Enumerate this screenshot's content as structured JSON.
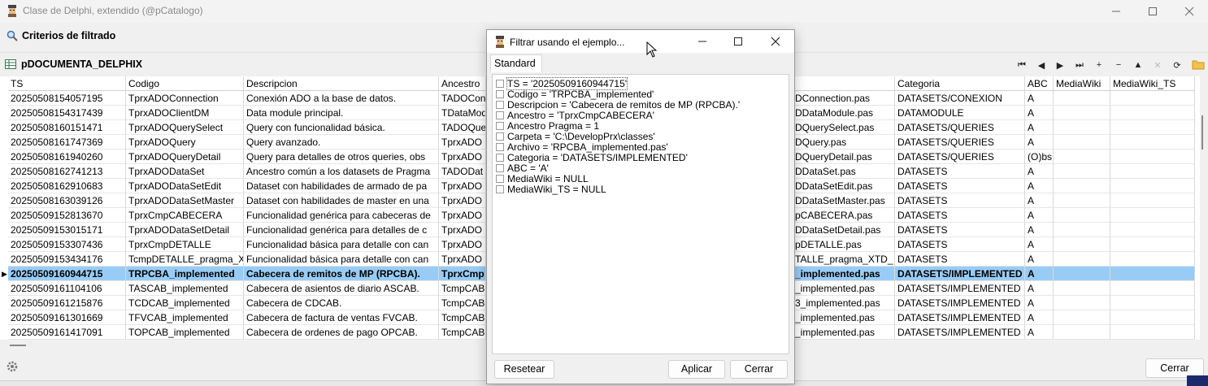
{
  "window": {
    "title": "Clase de Delphi, extendido (@pCatalogo)",
    "minimize": "—",
    "maximize": "☐",
    "close": "✕"
  },
  "filter_section": {
    "label": "Criterios de filtrado"
  },
  "dataset": {
    "name": "pDOCUMENTA_DELPHIX"
  },
  "nav_buttons": [
    {
      "name": "first-record-button",
      "glyph": "⏮"
    },
    {
      "name": "prior-record-button",
      "glyph": "◀"
    },
    {
      "name": "next-record-button",
      "glyph": "▶"
    },
    {
      "name": "last-record-button",
      "glyph": "⏭"
    },
    {
      "name": "insert-record-button",
      "glyph": "+"
    },
    {
      "name": "delete-record-button",
      "glyph": "−"
    },
    {
      "name": "edit-record-button",
      "glyph": "▲"
    },
    {
      "name": "cancel-edit-button",
      "glyph": "✕"
    },
    {
      "name": "refresh-button",
      "glyph": "⟳"
    }
  ],
  "grid": {
    "columns": [
      "TS",
      "Codigo",
      "Descripcion",
      "Ancestro",
      "",
      "Categoria",
      "ABC",
      "MediaWiki",
      "MediaWiki_TS"
    ],
    "rows": [
      [
        "20250508154057195",
        "TprxADOConnection",
        "Conexión ADO a la base de datos.",
        "TADOCon",
        "DConnection.pas",
        "DATASETS/CONEXION",
        "A",
        "",
        ""
      ],
      [
        "20250508154317439",
        "TprxADOClientDM",
        "Data module principal.",
        "TDataMod",
        "DDataModule.pas",
        "DATAMODULE",
        "A",
        "",
        ""
      ],
      [
        "20250508160151471",
        "TprxADOQuerySelect",
        "Query con funcionalidad básica.",
        "TADOQue",
        "DQuerySelect.pas",
        "DATASETS/QUERIES",
        "A",
        "",
        ""
      ],
      [
        "20250508161747369",
        "TprxADOQuery",
        "Query avanzado.",
        "TprxADO",
        "DQuery.pas",
        "DATASETS/QUERIES",
        "A",
        "",
        ""
      ],
      [
        "20250508161940260",
        "TprxADOQueryDetail",
        "Query para detalles de otros queries, obs",
        "TprxADO",
        "DQueryDetail.pas",
        "DATASETS/QUERIES",
        "(O)bs",
        "",
        ""
      ],
      [
        "20250508162741213",
        "TprxADODataSet",
        "Ancestro común a los datasets de Pragma",
        "TADODat",
        "DDataSet.pas",
        "DATASETS",
        "A",
        "",
        ""
      ],
      [
        "20250508162910683",
        "TprxADODataSetEdit",
        "Dataset con habilidades de armado de pa",
        "TprxADO",
        "DDataSetEdit.pas",
        "DATASETS",
        "A",
        "",
        ""
      ],
      [
        "20250508163039126",
        "TprxADODataSetMaster",
        "Dataset con habilidades de master en una",
        "TprxADO",
        "DDataSetMaster.pas",
        "DATASETS",
        "A",
        "",
        ""
      ],
      [
        "20250509152813670",
        "TprxCmpCABECERA",
        "Funcionalidad genérica para cabeceras de",
        "TprxADO",
        "pCABECERA.pas",
        "DATASETS",
        "A",
        "",
        ""
      ],
      [
        "20250509153015171",
        "TprxADODataSetDetail",
        "Funcionalidad genérica para detalles de c",
        "TprxADO",
        "DDataSetDetail.pas",
        "DATASETS",
        "A",
        "",
        ""
      ],
      [
        "20250509153307436",
        "TprxCmpDETALLE",
        "Funcionalidad básica para detalle con can",
        "TprxADO",
        "pDETALLE.pas",
        "DATASETS",
        "A",
        "",
        ""
      ],
      [
        "20250509153434176",
        "TcmpDETALLE_pragma_X",
        "Funcionalidad básica para detalle con can",
        "TprxADO",
        "TALLE_pragma_XTD_",
        "DATASETS",
        "A",
        "",
        ""
      ],
      [
        "20250509160944715",
        "TRPCBA_implemented",
        "Cabecera de remitos de MP (RPCBA).",
        "TprxCmp",
        "_implemented.pas",
        "DATASETS/IMPLEMENTED",
        "A",
        "",
        ""
      ],
      [
        "20250509161104106",
        "TASCAB_implemented",
        "Cabecera de asientos de diario ASCAB.",
        "TcmpCAB",
        "_implemented.pas",
        "DATASETS/IMPLEMENTED",
        "A",
        "",
        ""
      ],
      [
        "20250509161215876",
        "TCDCAB_implemented",
        "Cabecera de CDCAB.",
        "TcmpCAB",
        "3_implemented.pas",
        "DATASETS/IMPLEMENTED",
        "A",
        "",
        ""
      ],
      [
        "20250509161301669",
        "TFVCAB_implemented",
        "Cabecera de factura de ventas FVCAB.",
        "TcmpCAB",
        "_implemented.pas",
        "DATASETS/IMPLEMENTED",
        "A",
        "",
        ""
      ],
      [
        "20250509161417091",
        "TOPCAB_implemented",
        "Cabecera de ordenes de pago OPCAB.",
        "TcmpCAB",
        "_implemented.pas",
        "DATASETS/IMPLEMENTED",
        "A",
        "",
        ""
      ]
    ]
  },
  "main_close_button": "Cerrar",
  "dialog": {
    "title": "Filtrar usando el ejemplo...",
    "tab": "Standard",
    "conditions": [
      "TS = '20250509160944715'",
      "Codigo = 'TRPCBA_implemented'",
      "Descripcion = 'Cabecera de remitos de MP (RPCBA).'",
      "Ancestro = 'TprxCmpCABECERA'",
      "Ancestro Pragma = 1",
      "Carpeta = 'C:\\DevelopPrx\\classes'",
      "Archivo = 'RPCBA_implemented.pas'",
      "Categoria = 'DATASETS/IMPLEMENTED'",
      "ABC = 'A'",
      "MediaWiki = NULL",
      "MediaWiki_TS = NULL"
    ],
    "reset_button": "Resetear",
    "apply_button": "Aplicar",
    "close_button": "Cerrar"
  }
}
